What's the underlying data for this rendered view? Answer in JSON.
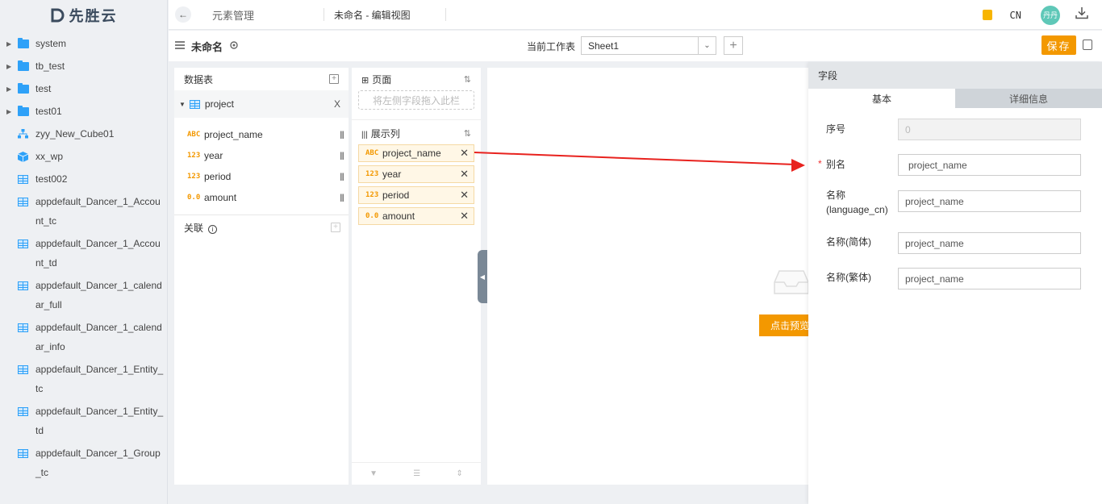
{
  "logo": {
    "text": "先胜云"
  },
  "sidebar": {
    "items": [
      {
        "label": "system",
        "type": "folder",
        "expandable": true
      },
      {
        "label": "tb_test",
        "type": "folder",
        "expandable": true
      },
      {
        "label": "test",
        "type": "folder",
        "expandable": true
      },
      {
        "label": "test01",
        "type": "folder",
        "expandable": true
      },
      {
        "label": "zyy_New_Cube01",
        "type": "cube",
        "expandable": false
      },
      {
        "label": "xx_wp",
        "type": "cube",
        "expandable": false
      },
      {
        "label": "test002",
        "type": "table",
        "expandable": false
      },
      {
        "label": "appdefault_Dancer_1_Account_tc",
        "type": "table",
        "expandable": false
      },
      {
        "label": "appdefault_Dancer_1_Account_td",
        "type": "table",
        "expandable": false
      },
      {
        "label": "appdefault_Dancer_1_calendar_full",
        "type": "table",
        "expandable": false
      },
      {
        "label": "appdefault_Dancer_1_calendar_info",
        "type": "table",
        "expandable": false
      },
      {
        "label": "appdefault_Dancer_1_Entity_tc",
        "type": "table",
        "expandable": false
      },
      {
        "label": "appdefault_Dancer_1_Entity_td",
        "type": "table",
        "expandable": false
      },
      {
        "label": "appdefault_Dancer_1_Group_tc",
        "type": "table",
        "expandable": false
      }
    ]
  },
  "topbar": {
    "breadcrumb": "元素管理",
    "tab_title": "未命名 - 编辑视图",
    "lang": "CN",
    "avatar": "丹丹"
  },
  "subbar": {
    "doc_name": "未命名",
    "sheet_label": "当前工作表",
    "sheet_value": "Sheet1",
    "save_label": "保存"
  },
  "data_panel": {
    "title": "数据表",
    "table_name": "project",
    "remove_label": "X",
    "fields": [
      {
        "type": "ABC",
        "name": "project_name"
      },
      {
        "type": "123",
        "name": "year"
      },
      {
        "type": "123",
        "name": "period"
      },
      {
        "type": "0.0",
        "name": "amount"
      }
    ],
    "relation_label": "关联"
  },
  "fields_panel": {
    "page_title": "页面",
    "drop_placeholder": "将左侧字段拖入此栏",
    "columns_title": "展示列",
    "columns": [
      {
        "type": "ABC",
        "name": "project_name"
      },
      {
        "type": "123",
        "name": "year"
      },
      {
        "type": "123",
        "name": "period"
      },
      {
        "type": "0.0",
        "name": "amount"
      }
    ]
  },
  "canvas": {
    "preview_button": "点击预览"
  },
  "props": {
    "title": "字段",
    "tabs": [
      "基本",
      "详细信息"
    ],
    "active_tab": 0,
    "rows": [
      {
        "label": "序号",
        "value": "0",
        "required": false,
        "disabled": true
      },
      {
        "label": "别名",
        "value": "project_name",
        "required": true,
        "disabled": false
      },
      {
        "label": "名称\n(language_cn)",
        "value": "project_name",
        "required": false,
        "disabled": false
      },
      {
        "label": "名称(简体)",
        "value": "project_name",
        "required": false,
        "disabled": false
      },
      {
        "label": "名称(繁体)",
        "value": "project_name",
        "required": false,
        "disabled": false
      }
    ]
  },
  "colors": {
    "accent": "#f39800",
    "folder": "#2ea1f8",
    "arrow": "#e8221e"
  }
}
